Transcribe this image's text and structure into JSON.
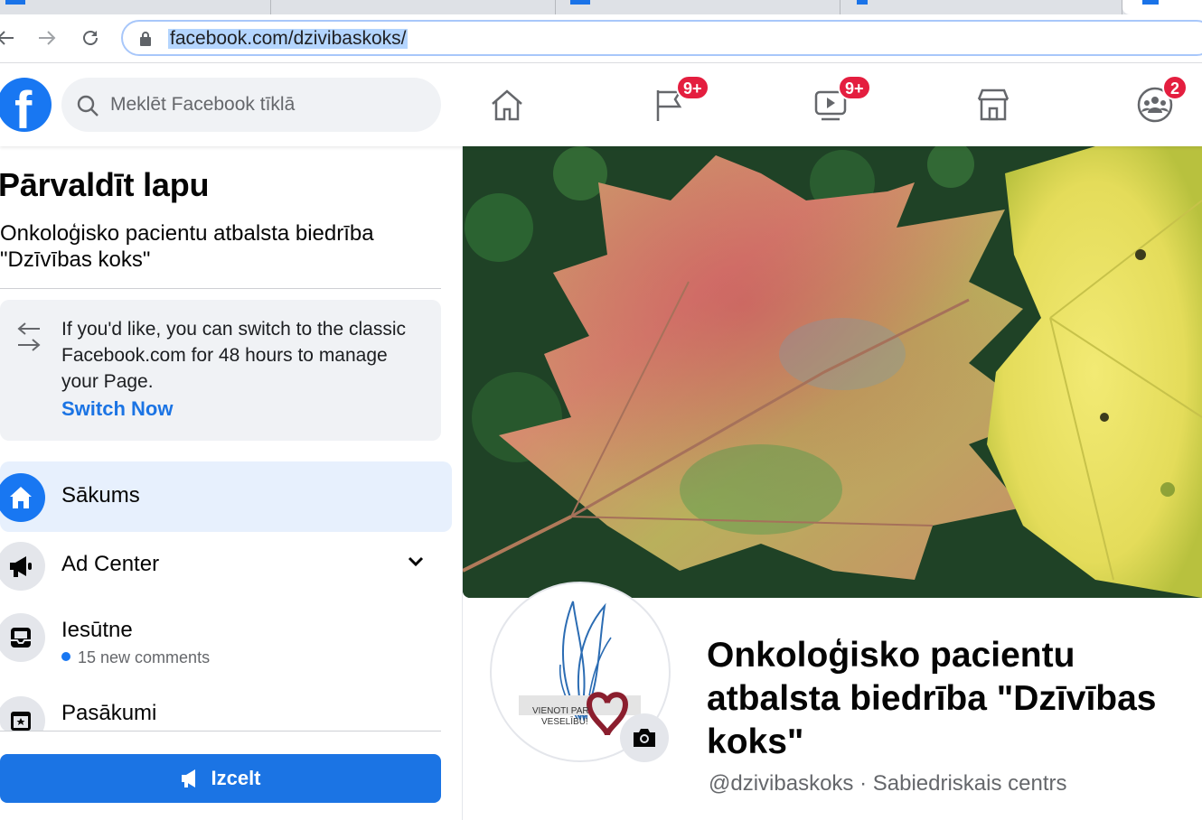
{
  "browser": {
    "url": "facebook.com/dzivibaskoks/"
  },
  "header": {
    "search_placeholder": "Meklēt Facebook tīklā",
    "badges": {
      "pages": "9+",
      "watch": "9+",
      "groups": "2"
    }
  },
  "sidebar": {
    "heading": "Pārvaldīt lapu",
    "page_name": "Onkoloģisko pacientu atbalsta biedrība \"Dzīvības koks\"",
    "switch_notice": {
      "message": "If you'd like, you can switch to the classic Facebook.com for 48 hours to manage your Page.",
      "link": "Switch Now"
    },
    "items": [
      {
        "label": "Sākums",
        "icon": "home-icon",
        "active": true
      },
      {
        "label": "Ad Center",
        "icon": "megaphone-icon"
      },
      {
        "label": "Iesūtne",
        "icon": "inbox-icon",
        "sub": "15 new comments"
      },
      {
        "label": "Pasākumi",
        "icon": "calendar-icon"
      }
    ],
    "boost_label": "Izcelt"
  },
  "main": {
    "title": "Onkoloģisko pacientu atbalsta biedrība \"Dzīvības koks\"",
    "subtitle": "@dzivibaskoks · Sabiedriskais centrs",
    "logo_text": "VIENOTI PAR VESELĪBU!"
  },
  "colors": {
    "brand": "#1877f2",
    "badge": "#e41e3f",
    "active_bg": "#e7f0fd"
  }
}
